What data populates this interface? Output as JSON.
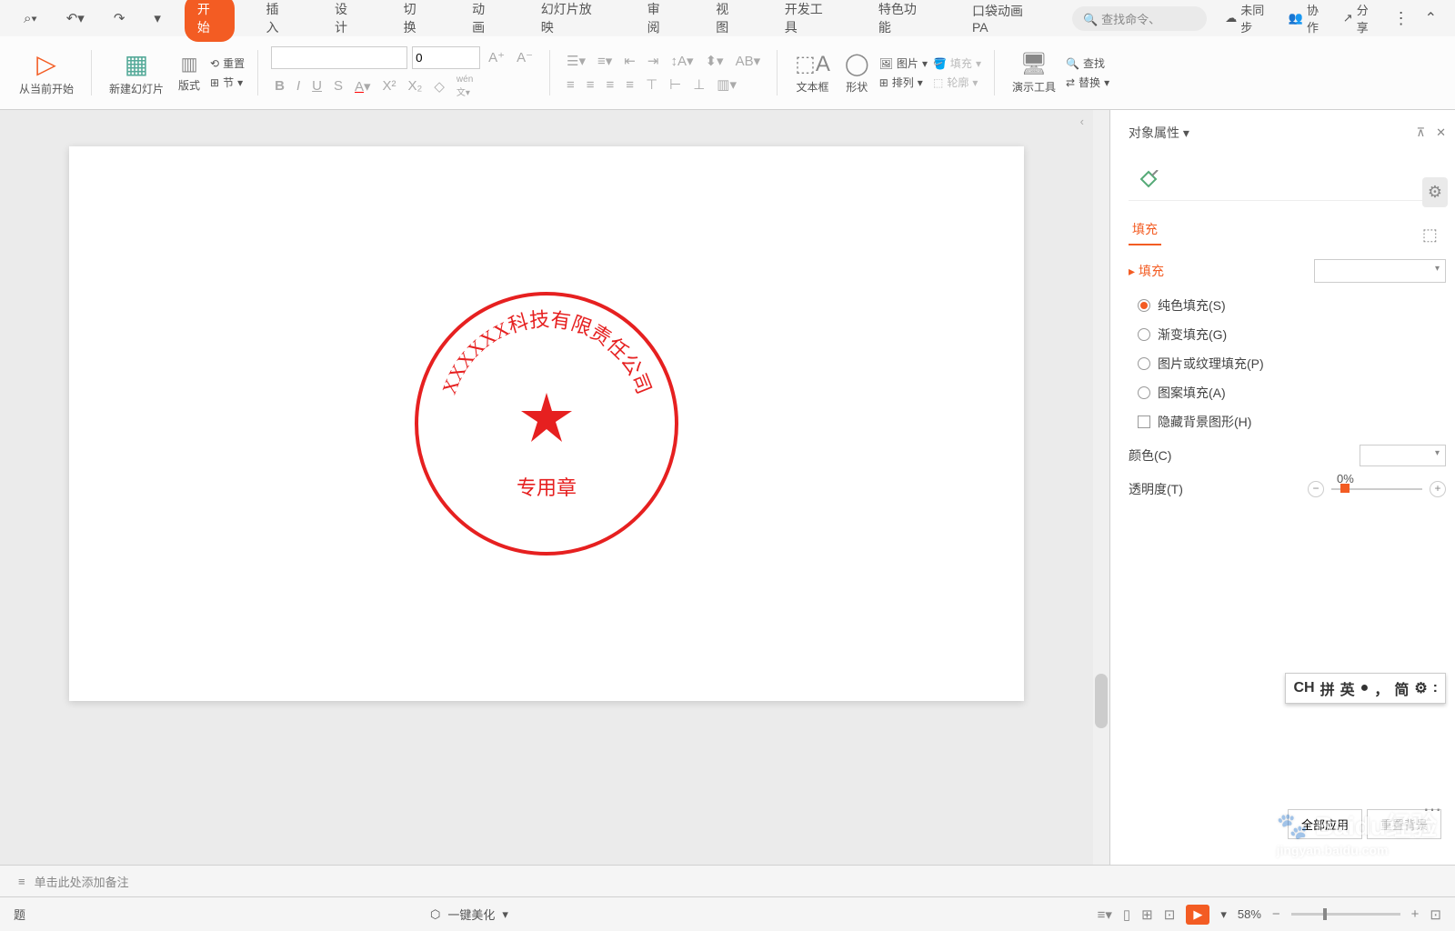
{
  "tabs": {
    "start": "开始",
    "insert": "插入",
    "design": "设计",
    "transition": "切换",
    "animation": "动画",
    "slideshow": "幻灯片放映",
    "review": "审阅",
    "view": "视图",
    "dev": "开发工具",
    "special": "特色功能",
    "pocket": "口袋动画 PA"
  },
  "search_placeholder": "查找命令、",
  "top_right": {
    "sync": "未同步",
    "collab": "协作",
    "share": "分享"
  },
  "ribbon": {
    "from_current": "从当前开始",
    "new_slide": "新建幻灯片",
    "layout": "版式",
    "reset": "重置",
    "section": "节",
    "font_size": "0",
    "textbox": "文本框",
    "shape": "形状",
    "picture": "图片",
    "fill": "填充",
    "arrange": "排列",
    "outline": "轮廓",
    "tools": "演示工具",
    "find": "查找",
    "replace": "替换"
  },
  "slide": {
    "company_arc": "XXXXXX科技有限责任公司",
    "stamp_text": "专用章"
  },
  "props": {
    "title": "对象属性",
    "tab_fill": "填充",
    "section_fill": "填充",
    "solid_fill": "纯色填充(S)",
    "gradient_fill": "渐变填充(G)",
    "picture_fill": "图片或纹理填充(P)",
    "pattern_fill": "图案填充(A)",
    "hide_bg": "隐藏背景图形(H)",
    "color": "颜色(C)",
    "transparency": "透明度(T)",
    "trans_val": "0%"
  },
  "ime": {
    "ch": "CH",
    "pin": "拼",
    "ying": "英",
    "jian": "简"
  },
  "apply": {
    "all": "全部应用",
    "reset_bg": "重置背景"
  },
  "notes_placeholder": "单击此处添加备注",
  "status": {
    "title": "题",
    "beautify": "一键美化",
    "zoom": "58%"
  },
  "watermark": {
    "main": "Baidu经验",
    "sub": "jingyan.baidu.com"
  }
}
